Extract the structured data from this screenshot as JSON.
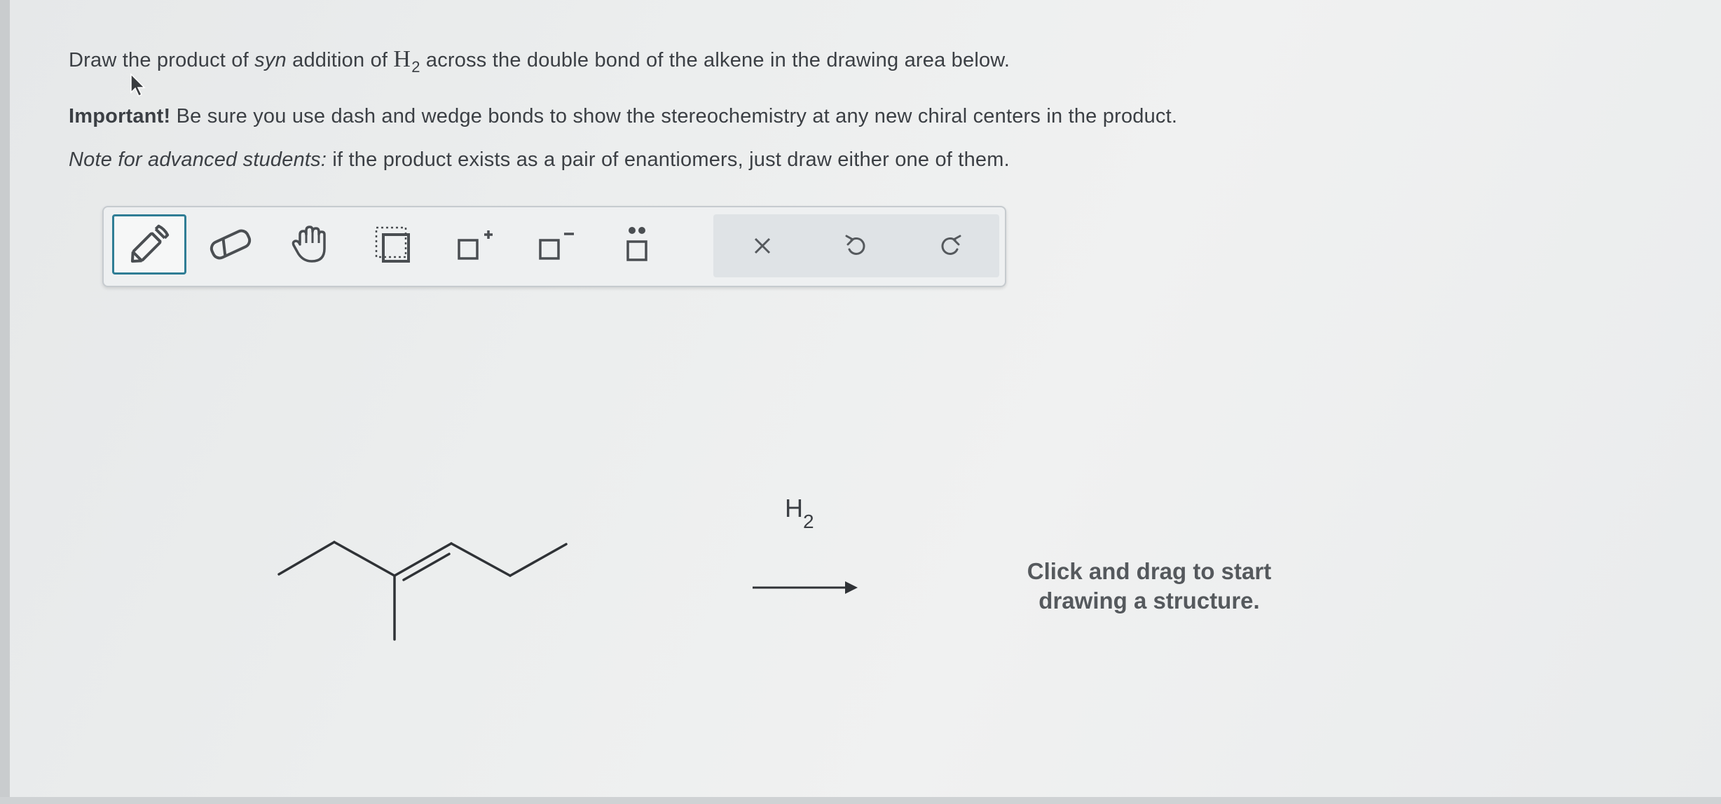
{
  "instructions": {
    "line1_pre": "Draw the product of ",
    "line1_em": "syn",
    "line1_mid": " addition of ",
    "line1_h": "H",
    "line1_sub": "2",
    "line1_post": " across the double bond of the alkene in the drawing area below.",
    "important_label": "Important!",
    "important_text": " Be sure you use dash and wedge bonds to show the stereochemistry at any new chiral centers in the product.",
    "note_label": "Note for advanced students:",
    "note_text": " if the product exists as a pair of enantiomers, just draw either one of them."
  },
  "toolbar": {
    "tools": [
      "pencil-icon",
      "eraser-icon",
      "hand-icon",
      "select-icon",
      "positive-charge-icon",
      "negative-charge-icon",
      "lone-pair-icon"
    ],
    "actions": [
      "close-icon",
      "undo-icon",
      "redo-icon"
    ],
    "active_tool": "pencil-icon",
    "active_color": "#2f7d95"
  },
  "reaction": {
    "reagent_main": "H",
    "reagent_sub": "2"
  },
  "drawing_area": {
    "prompt": "Click and drag to start drawing a structure."
  }
}
